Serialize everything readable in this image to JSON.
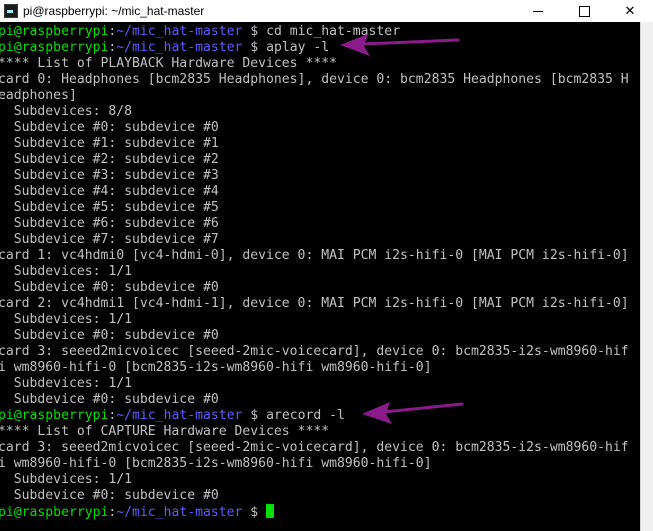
{
  "window": {
    "title": "pi@raspberrypi: ~/mic_hat-master",
    "controls": {
      "minimize": "",
      "maximize": "",
      "close": "✕"
    }
  },
  "colors": {
    "background": "#000000",
    "text": "#c0c0c0",
    "prompt_user": "#00e000",
    "prompt_path": "#5c5cff",
    "arrow": "#8b1a8b"
  },
  "terminal": {
    "prompt_user": "pi@raspberrypi",
    "prompt_sep": ":",
    "prompt_path": "~/mic_hat-master",
    "prompt_tail": " $ ",
    "lines": [
      "",
      "",
      "**** List of PLAYBACK Hardware Devices ****",
      "card 0: Headphones [bcm2835 Headphones], device 0: bcm2835 Headphones [bcm2835 H",
      "eadphones]",
      "  Subdevices: 8/8",
      "  Subdevice #0: subdevice #0",
      "  Subdevice #1: subdevice #1",
      "  Subdevice #2: subdevice #2",
      "  Subdevice #3: subdevice #3",
      "  Subdevice #4: subdevice #4",
      "  Subdevice #5: subdevice #5",
      "  Subdevice #6: subdevice #6",
      "  Subdevice #7: subdevice #7",
      "card 1: vc4hdmi0 [vc4-hdmi-0], device 0: MAI PCM i2s-hifi-0 [MAI PCM i2s-hifi-0]",
      "  Subdevices: 1/1",
      "  Subdevice #0: subdevice #0",
      "card 2: vc4hdmi1 [vc4-hdmi-1], device 0: MAI PCM i2s-hifi-0 [MAI PCM i2s-hifi-0]",
      "  Subdevices: 1/1",
      "  Subdevice #0: subdevice #0",
      "card 3: seeed2micvoicec [seeed-2mic-voicecard], device 0: bcm2835-i2s-wm8960-hif",
      "i wm8960-hifi-0 [bcm2835-i2s-wm8960-hifi wm8960-hifi-0]",
      "  Subdevices: 1/1",
      "  Subdevice #0: subdevice #0",
      "",
      "**** List of CAPTURE Hardware Devices ****",
      "card 3: seeed2micvoicec [seeed-2mic-voicecard], device 0: bcm2835-i2s-wm8960-hif",
      "i wm8960-hifi-0 [bcm2835-i2s-wm8960-hifi wm8960-hifi-0]",
      "  Subdevices: 1/1",
      "  Subdevice #0: subdevice #0",
      ""
    ],
    "commands": {
      "cmd0": "cd mic_hat-master",
      "cmd1": "aplay -l",
      "cmd2": "arecord -l"
    }
  }
}
